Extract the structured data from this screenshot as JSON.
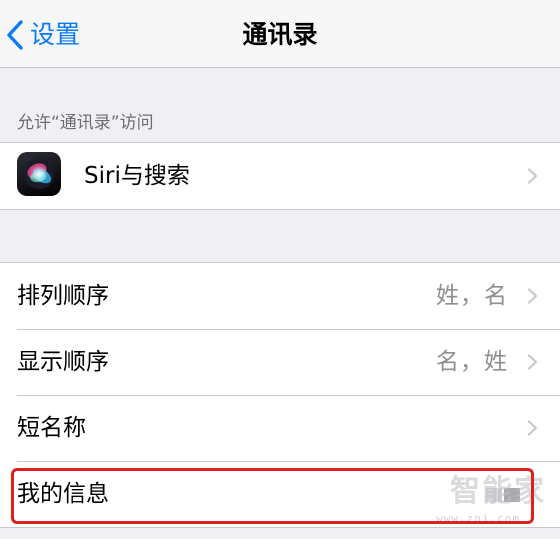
{
  "navbar": {
    "back_label": "设置",
    "title": "通讯录"
  },
  "access_section": {
    "header": "允许“通讯录”访问",
    "siri_label": "Siri与搜索",
    "siri_icon": "siri-icon"
  },
  "settings_group": {
    "rows": [
      {
        "label": "排列顺序",
        "value": "姓，名"
      },
      {
        "label": "显示顺序",
        "value": "名，姓"
      },
      {
        "label": "短名称",
        "value": ""
      },
      {
        "label": "我的信息",
        "value": ""
      }
    ]
  },
  "watermark": {
    "text": "智能家",
    "url": "www.znj.com"
  },
  "colors": {
    "accent": "#0a7bf7",
    "highlight": "#e02020",
    "background": "#efeff4",
    "secondary_text": "#8e8e93"
  }
}
